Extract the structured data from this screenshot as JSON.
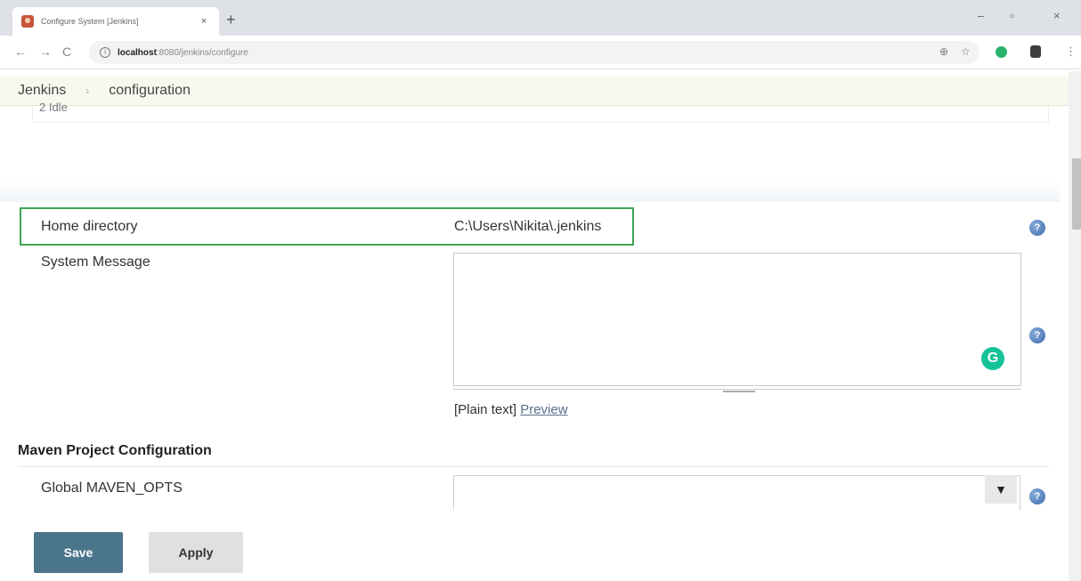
{
  "browser": {
    "tab_title": "Configure System [Jenkins]",
    "tab_close": "×",
    "new_tab": "+",
    "minimize": "–",
    "maximize": "▫",
    "close": "×",
    "url_host": "localhost",
    "url_path": ":8080/jenkins/configure",
    "back": "←",
    "forward": "→",
    "reload": "C",
    "info": "i",
    "zoom_icon": "⊕",
    "star_icon": "☆",
    "menu": "⋮"
  },
  "breadcrumb": {
    "root": "Jenkins",
    "separator": "›",
    "current": "configuration"
  },
  "cut_off_text": "2 Idle",
  "home_directory": {
    "label": "Home directory",
    "value": "C:\\Users\\Nikita\\.jenkins"
  },
  "system_message": {
    "label": "System Message",
    "value": "",
    "format_prefix": "[Plain text]",
    "preview_link": "Preview"
  },
  "maven_section": {
    "title": "Maven Project Configuration",
    "global_opts_label": "Global MAVEN_OPTS",
    "global_opts_value": "",
    "dropdown_arrow": "▼"
  },
  "help_glyph": "?",
  "grammarly_glyph": "G",
  "buttons": {
    "save": "Save",
    "apply": "Apply"
  },
  "colors": {
    "highlight": "#3ea453",
    "save_button": "#4b758b",
    "apply_button": "#e0e0e0",
    "breadcrumb_bg": "#f7f9ee",
    "grammarly": "#15c39a"
  },
  "icons": [
    "jenkins-favicon-icon",
    "info-icon",
    "zoom-icon",
    "star-icon",
    "extension-icon",
    "help-icon",
    "grammarly-icon",
    "dropdown-arrow-icon"
  ]
}
